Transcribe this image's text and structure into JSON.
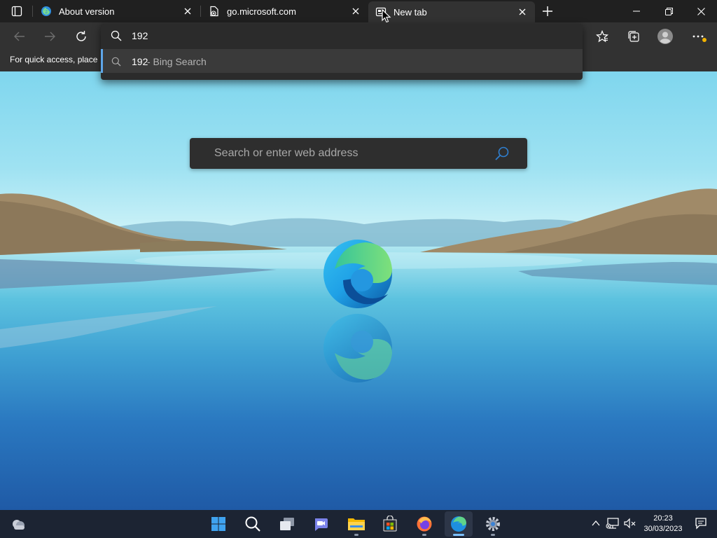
{
  "tabs": [
    {
      "title": "About version",
      "favicon": "edge-icon",
      "close": "✕"
    },
    {
      "title": "go.microsoft.com",
      "favicon": "document-error-icon",
      "close": "✕"
    },
    {
      "title": "New tab",
      "favicon": "new-tab-page-icon",
      "close": "✕",
      "active": true
    }
  ],
  "new_tab_label": "+",
  "favorites_bar": {
    "message": "For quick access, place your favorites here on the favorites bar."
  },
  "omnibox": {
    "query": "192",
    "suggestion": {
      "query": "192",
      "source": "- Bing Search"
    }
  },
  "search": {
    "placeholder": "Search or enter web address"
  },
  "taskbar": {
    "apps": [
      "windows-start-icon",
      "search-icon",
      "task-view-icon",
      "teams-chat-icon",
      "file-explorer-icon",
      "microsoft-store-icon",
      "firefox-icon",
      "edge-icon",
      "settings-icon"
    ],
    "active_app": "edge-icon"
  },
  "clock": {
    "time": "20:23",
    "date": "30/03/2023"
  },
  "colors": {
    "accent": "#5ea6e8",
    "tab_bar": "#202020",
    "toolbar": "#323232",
    "taskbar": "#1c2433"
  }
}
